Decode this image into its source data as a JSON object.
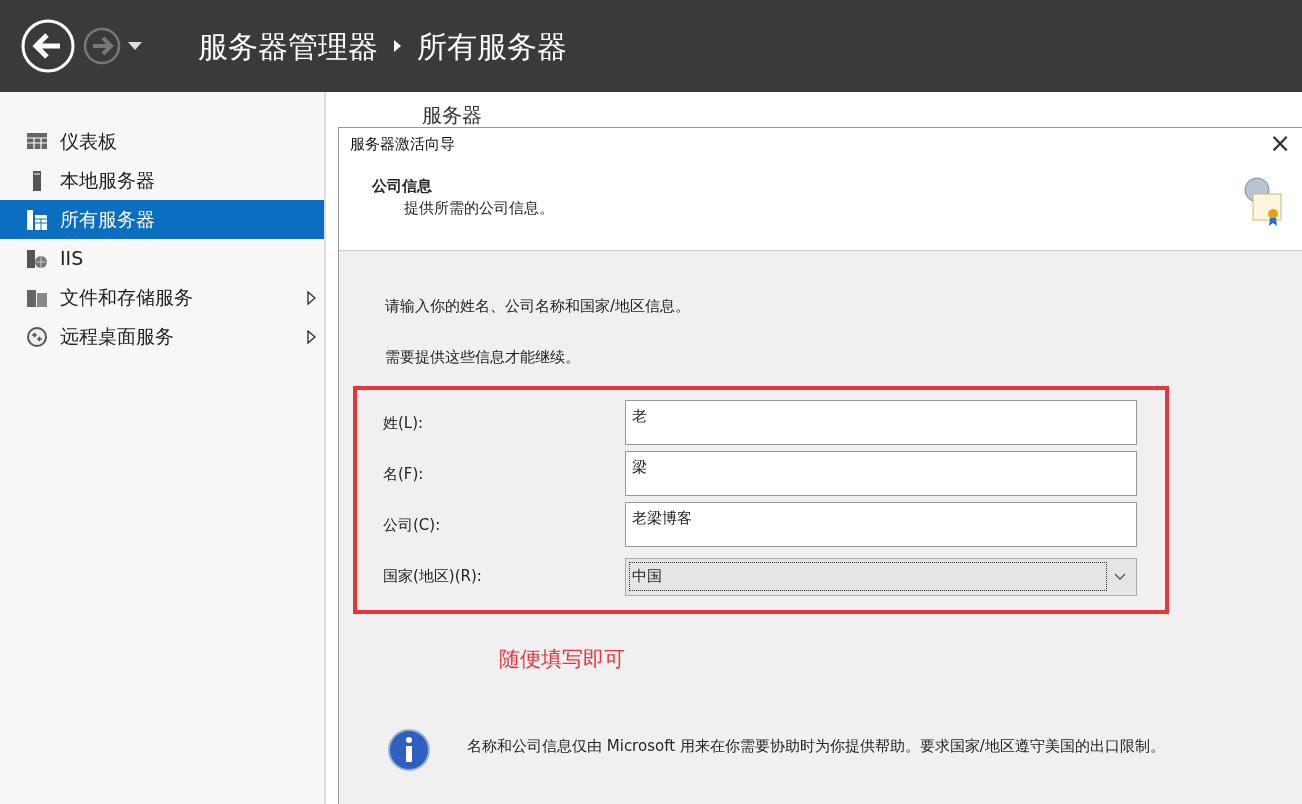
{
  "header": {
    "breadcrumb": [
      "服务器管理器",
      "所有服务器"
    ]
  },
  "sidebar": {
    "items": [
      {
        "label": "仪表板",
        "selected": false,
        "submenu": false
      },
      {
        "label": "本地服务器",
        "selected": false,
        "submenu": false
      },
      {
        "label": "所有服务器",
        "selected": true,
        "submenu": false
      },
      {
        "label": "IIS",
        "selected": false,
        "submenu": false
      },
      {
        "label": "文件和存储服务",
        "selected": false,
        "submenu": true
      },
      {
        "label": "远程桌面服务",
        "selected": false,
        "submenu": true
      }
    ]
  },
  "main": {
    "heading": "服务器"
  },
  "dialog": {
    "title": "服务器激活向导",
    "close": "×",
    "section_title": "公司信息",
    "section_subtitle": "提供所需的公司信息。",
    "intro": "请输入你的姓名、公司名称和国家/地区信息。",
    "required_note": "需要提供这些信息才能继续。",
    "fields": [
      {
        "kind": "text",
        "label": "姓(L):",
        "value": "老"
      },
      {
        "kind": "text",
        "label": "名(F):",
        "value": "梁"
      },
      {
        "kind": "text",
        "label": "公司(C):",
        "value": "老梁博客"
      },
      {
        "kind": "select",
        "label": "国家(地区)(R):",
        "value": "中国"
      }
    ],
    "annotation": "随便填写即可",
    "info": "名称和公司信息仅由 Microsoft 用来在你需要协助时为你提供帮助。要求国家/地区遵守美国的出口限制。"
  }
}
